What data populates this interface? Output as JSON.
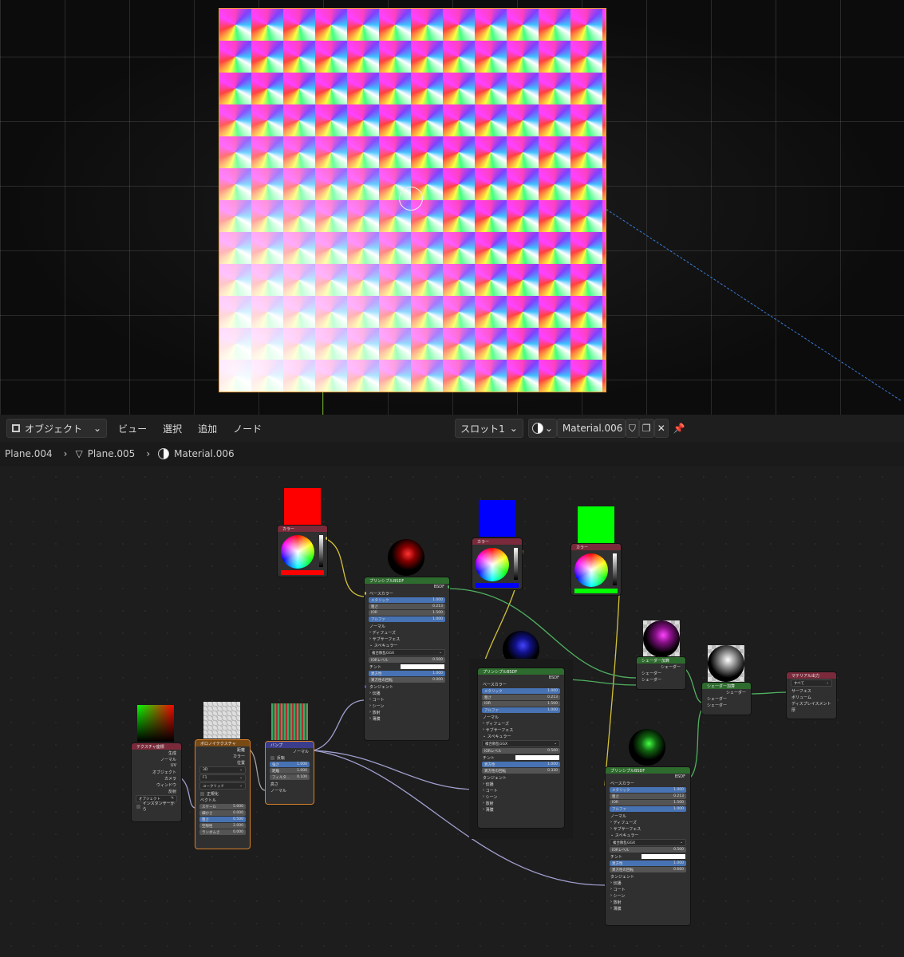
{
  "header": {
    "mode": "オブジェクト",
    "menus": [
      "ビュー",
      "選択",
      "追加",
      "ノード"
    ],
    "slot": "スロット1",
    "material": "Material.006"
  },
  "breadcrumb": {
    "items": [
      "Plane.004",
      "Plane.005",
      "Material.006"
    ]
  },
  "nodes": {
    "tex_coord": {
      "title": "テクスチャ座標",
      "outputs": [
        "生成",
        "ノーマル",
        "UV",
        "オブジェクト",
        "カメラ",
        "ウィンドウ",
        "反射"
      ],
      "object_placeholder": "オブジェクト",
      "from_instancer": "インスタンサーから"
    },
    "voronoi": {
      "title": "ボロノイテクスチャ",
      "outputs": [
        "距離",
        "カラー",
        "位置"
      ],
      "dim": "3D",
      "feature": "F1",
      "metric": "ユークリッド",
      "normalize": "正規化",
      "vector": "ベクトル",
      "fields": [
        {
          "label": "スケール",
          "value": "5.000"
        },
        {
          "label": "細かさ",
          "value": "0.000"
        },
        {
          "label": "粗さ",
          "value": "0.500"
        },
        {
          "label": "空隙性",
          "value": "2.000"
        },
        {
          "label": "ランダムさ",
          "value": "0.000"
        }
      ]
    },
    "bump": {
      "title": "バンプ",
      "output": "ノーマル",
      "invert": "反転",
      "fields": [
        {
          "label": "強さ",
          "value": "1.000"
        },
        {
          "label": "距離",
          "value": "1.000"
        },
        {
          "label": "フィルタ...",
          "value": "0.100"
        }
      ],
      "height": "高さ",
      "normal": "ノーマル"
    },
    "color_red": {
      "title": "カラー",
      "swatch": "#ff0000"
    },
    "color_blue": {
      "title": "カラー",
      "swatch": "#0000ff"
    },
    "color_green": {
      "title": "カラー",
      "swatch": "#00ff00"
    },
    "bsdf": {
      "title": "プリンシプルBSDF",
      "out": "BSDF",
      "base_color": "ベースカラー",
      "metallic": "メタリック",
      "roughness": "粗さ",
      "ior": "IOR",
      "alpha": "アルファ",
      "normal": "ノーマル",
      "diffuse": "ディフューズ",
      "subsurface": "サブサーフェス",
      "specular": "スペキュラー",
      "distribution": "複合散乱GGX",
      "ior_level": "IORレベル",
      "tint": "チント",
      "aniso": "異方性",
      "aniso_rot": "異方性の回転",
      "tangent": "タンジェント",
      "transmission": "伝播",
      "coat": "コート",
      "sheen": "シーン",
      "emission": "放射",
      "thin_film": "薄膜"
    },
    "bsdf1_vals": {
      "metallic": "1.000",
      "roughness": "0.213",
      "ior": "1.500",
      "alpha": "1.000",
      "ior_level": "0.500",
      "aniso": "1.000",
      "aniso_rot": "0.000"
    },
    "bsdf2_vals": {
      "metallic": "1.000",
      "roughness": "0.213",
      "ior": "1.500",
      "alpha": "1.000",
      "ior_level": "0.500",
      "aniso": "1.000",
      "aniso_rot": "0.330"
    },
    "bsdf3_vals": {
      "metallic": "1.000",
      "roughness": "0.213",
      "ior": "1.500",
      "alpha": "1.000",
      "ior_level": "0.500",
      "aniso": "1.000",
      "aniso_rot": "0.660"
    },
    "add": {
      "title": "シェーダー加算",
      "out": "シェーダー",
      "in": "シェーダー"
    },
    "output": {
      "title": "マテリアル出力",
      "target": "すべて",
      "surface": "サーフェス",
      "volume": "ボリューム",
      "displacement": "ディスプレイスメント",
      "thickness": "厚"
    }
  },
  "colors": {
    "accent": "#4772b3",
    "selection": "#d9822b",
    "shader_header": "#2e6b2e",
    "texture_header": "#7a4a14",
    "vector_header": "#3c3c8c",
    "input_header": "#7a2a3a"
  }
}
